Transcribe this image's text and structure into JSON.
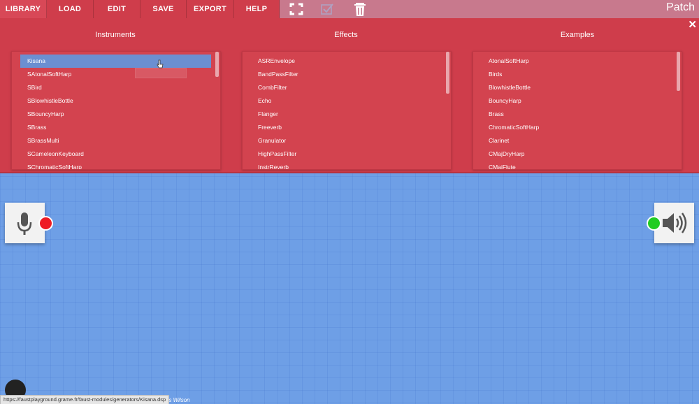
{
  "menu": {
    "items": [
      {
        "label": "LIBRARY"
      },
      {
        "label": "LOAD"
      },
      {
        "label": "EDIT"
      },
      {
        "label": "SAVE"
      },
      {
        "label": "EXPORT"
      },
      {
        "label": "HELP"
      }
    ],
    "icons": [
      "fullscreen-icon",
      "checkbox-icon",
      "trash-icon"
    ],
    "patch_title": "Patch"
  },
  "library": {
    "close_label": "✕",
    "columns": [
      {
        "title": "Instruments",
        "selected": "Kisana",
        "items": [
          "SAtonalSoftHarp",
          "SBird",
          "SBlowhistleBottle",
          "SBouncyHarp",
          "SBrass",
          "SBrassMulti",
          "SCameleonKeyboard",
          "SChromaticSoftHarp"
        ]
      },
      {
        "title": "Effects",
        "items": [
          "ASREnvelope",
          "BandPassFilter",
          "CombFilter",
          "Echo",
          "Flanger",
          "Freeverb",
          "Granulator",
          "HighPassFilter",
          "InstrReverb"
        ]
      },
      {
        "title": "Examples",
        "items": [
          "AtonalSoftHarp",
          "Birds",
          "BlowhistleBottle",
          "BouncyHarp",
          "Brass",
          "ChromaticSoftHarp",
          "Clarinet",
          "CMajDryHarp",
          "CMajFlute"
        ]
      }
    ]
  },
  "io": {
    "input_icon": "microphone-icon",
    "input_dot_color": "#ee1c24",
    "output_icon": "speaker-icon",
    "output_dot_color": "#22cc22"
  },
  "footer": {
    "status_url": "https://faustplayground.grame.fr/faust-modules/generators/Kisana.dsp",
    "credit": "ris Wilson"
  },
  "colors": {
    "accent": "#cf3d4b",
    "selection": "#6b8fd1",
    "workspace": "#6e9fe6"
  }
}
